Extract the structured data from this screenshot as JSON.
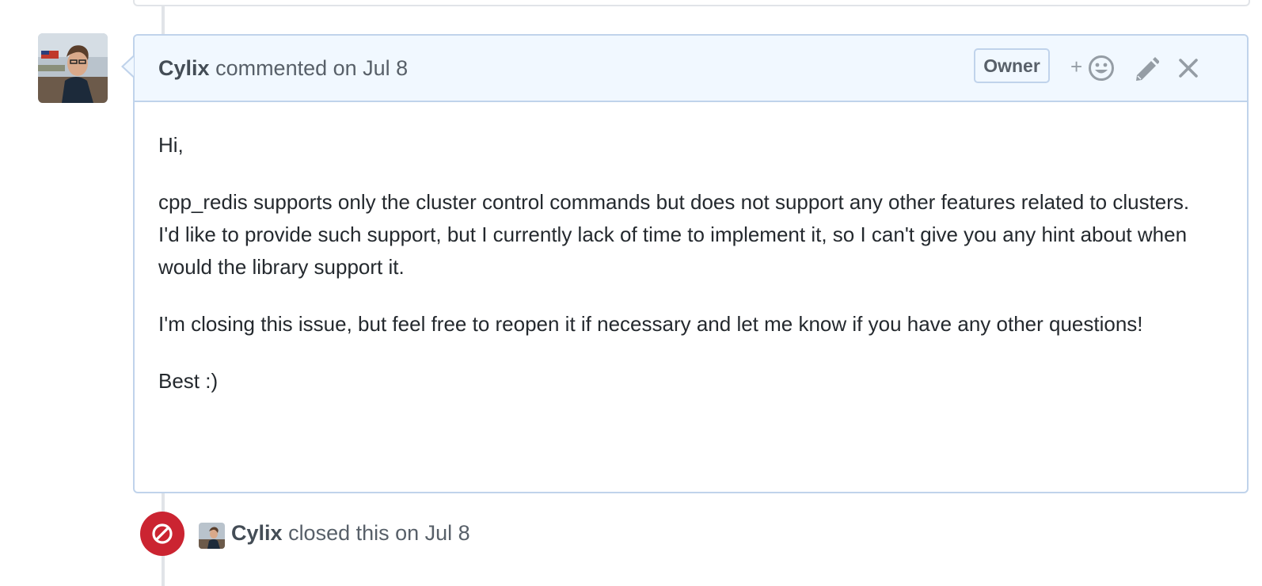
{
  "comment": {
    "author": "Cylix",
    "action_text": "commented on Jul 8",
    "badge": "Owner",
    "reaction_plus": "+",
    "icons": [
      "add-reaction-icon",
      "pencil-icon",
      "close-icon"
    ],
    "body": [
      "Hi,",
      "cpp_redis supports only the cluster control commands but does not support any other features related to clusters.",
      "I'd like to provide such support, but I currently lack of time to implement it, so I can't give you any hint about when would the library support it.",
      "I'm closing this issue, but feel free to reopen it if necessary and let me know if you have any other questions!",
      "Best :)"
    ]
  },
  "event": {
    "author": "Cylix",
    "action_text": "closed this on Jul 8",
    "icon": "closed-circle-slash-icon",
    "color": "#cb2431"
  },
  "colors": {
    "header_bg": "#f1f8ff",
    "header_border": "#c0d3eb",
    "timeline": "#e1e4e8",
    "muted_text": "#586069"
  }
}
